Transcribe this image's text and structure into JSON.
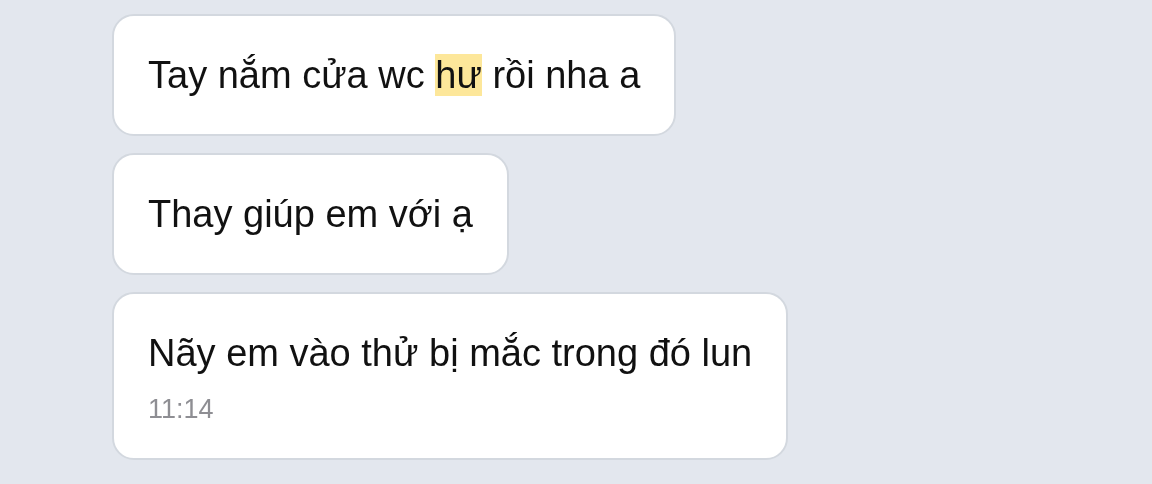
{
  "messages": [
    {
      "parts": [
        {
          "text": "Tay nắm cửa wc ",
          "highlighted": false
        },
        {
          "text": "hư",
          "highlighted": true
        },
        {
          "text": " rồi nha a",
          "highlighted": false
        }
      ]
    },
    {
      "parts": [
        {
          "text": "Thay giúp em với ạ",
          "highlighted": false
        }
      ]
    },
    {
      "parts": [
        {
          "text": "Nãy em vào thử bị mắc trong đó lun",
          "highlighted": false
        }
      ],
      "time": "11:14"
    }
  ]
}
